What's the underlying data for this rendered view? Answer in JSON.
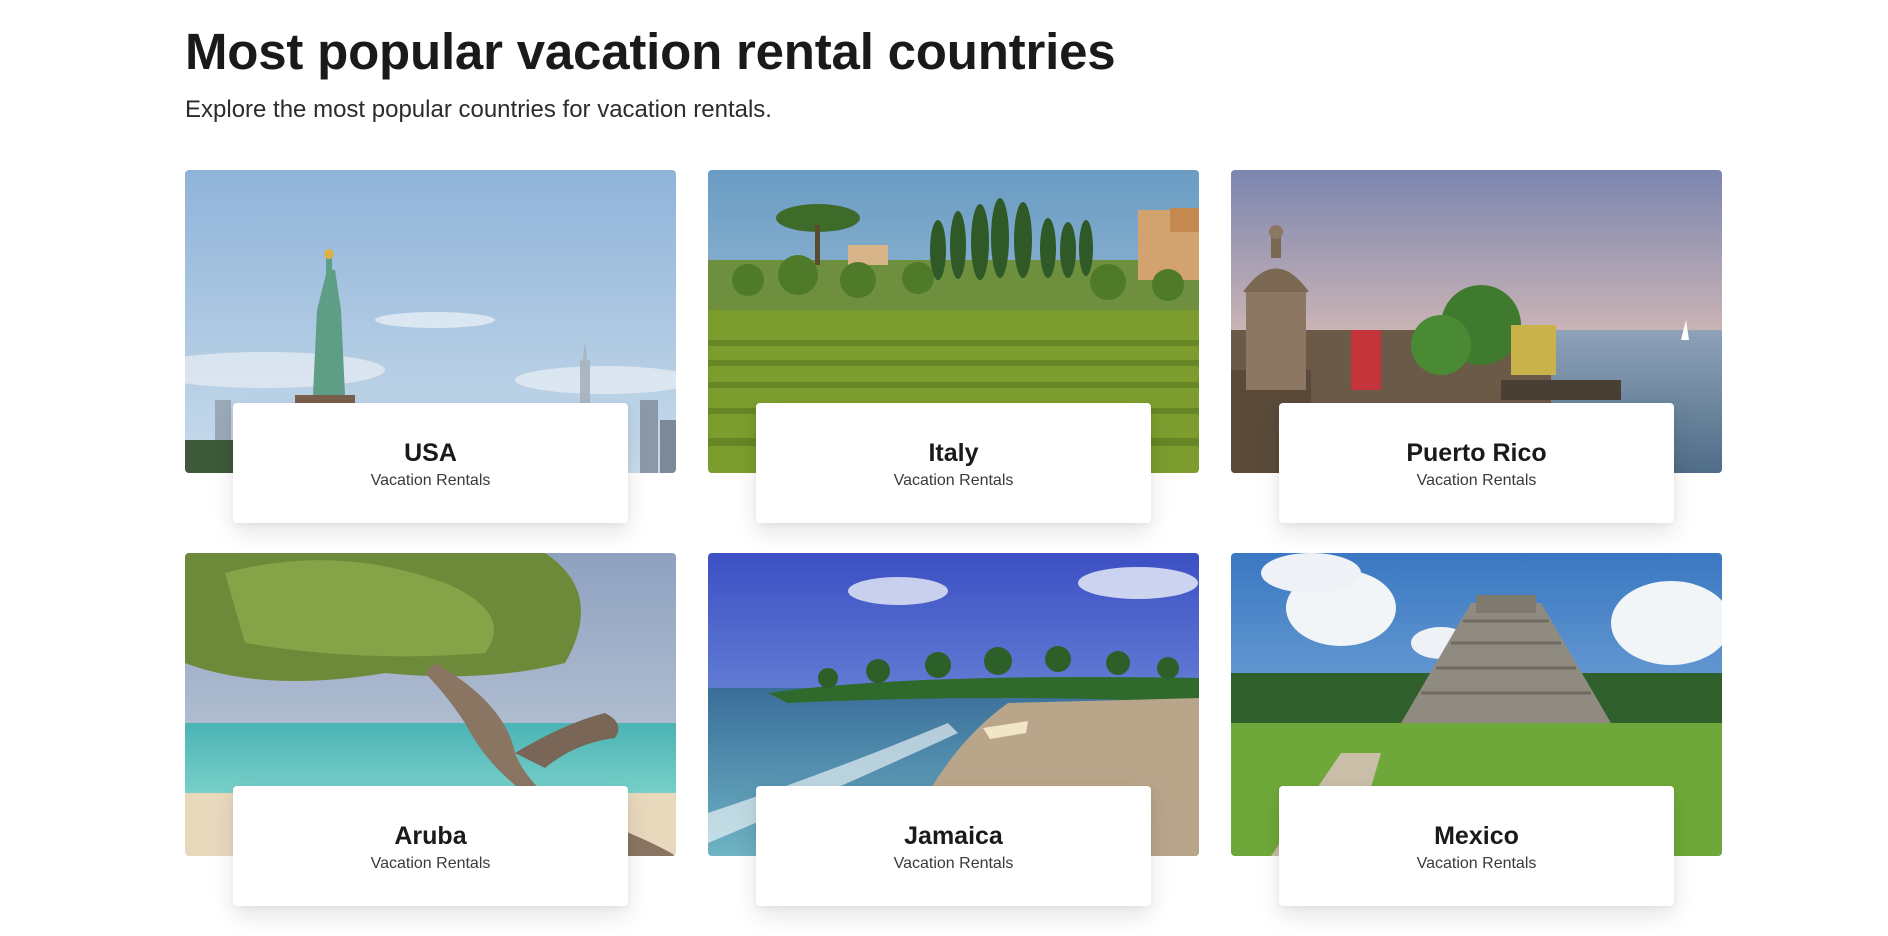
{
  "header": {
    "title": "Most popular vacation rental countries",
    "subtitle": "Explore the most popular countries for vacation rentals."
  },
  "destinations": [
    {
      "name": "USA",
      "subtitle": "Vacation Rentals",
      "image": "statue-of-liberty-skyline"
    },
    {
      "name": "Italy",
      "subtitle": "Vacation Rentals",
      "image": "tuscany-vineyard-cypress"
    },
    {
      "name": "Puerto Rico",
      "subtitle": "Vacation Rentals",
      "image": "san-juan-fort-sea"
    },
    {
      "name": "Aruba",
      "subtitle": "Vacation Rentals",
      "image": "divi-divi-tree-beach"
    },
    {
      "name": "Jamaica",
      "subtitle": "Vacation Rentals",
      "image": "palm-beach-boat"
    },
    {
      "name": "Mexico",
      "subtitle": "Vacation Rentals",
      "image": "chichen-itza-pyramid"
    }
  ]
}
